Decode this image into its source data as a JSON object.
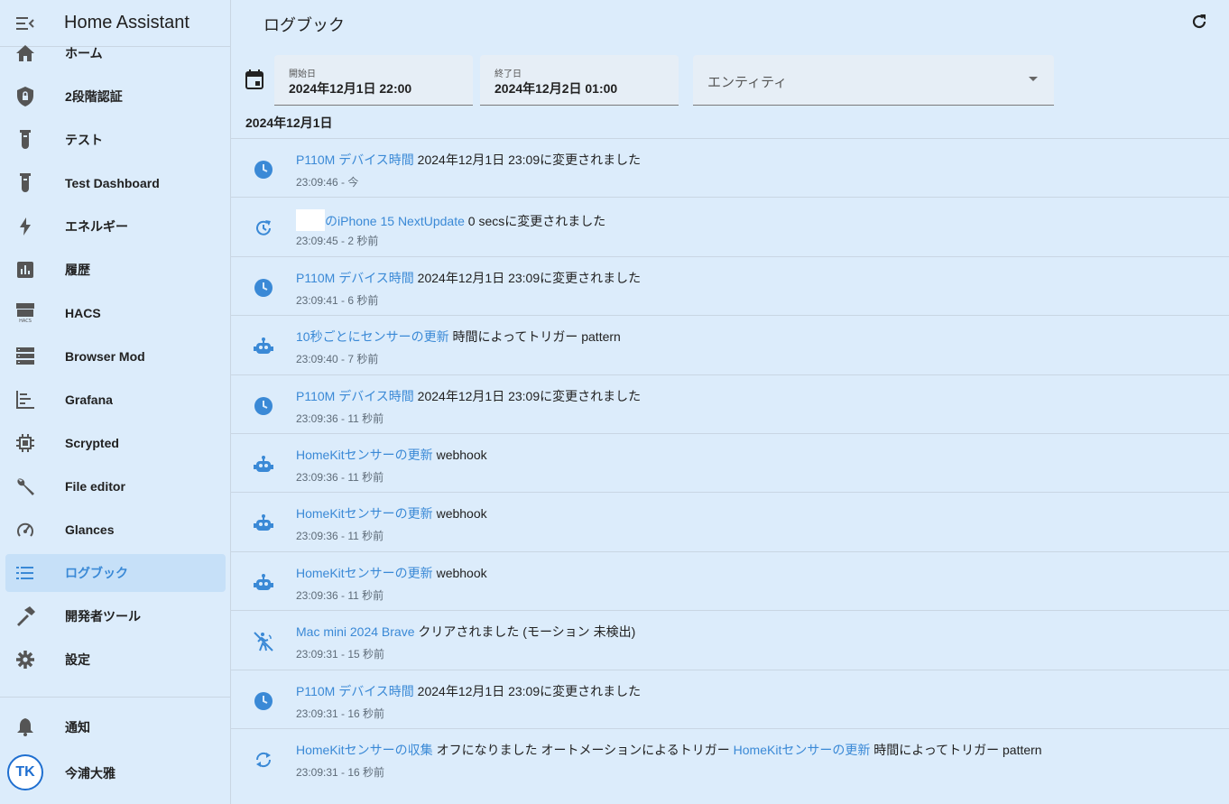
{
  "app": {
    "title": "Home Assistant"
  },
  "colors": {
    "accent": "#3a89d6",
    "background": "#dcecfb",
    "active_item_bg": "#c6e0f8"
  },
  "sidebar": {
    "items": [
      {
        "label": "ホーム",
        "icon": "home-icon"
      },
      {
        "label": "2段階認証",
        "icon": "shield-lock-icon"
      },
      {
        "label": "テスト",
        "icon": "test-tube-icon"
      },
      {
        "label": "Test Dashboard",
        "icon": "test-tube-icon"
      },
      {
        "label": "エネルギー",
        "icon": "lightning-icon"
      },
      {
        "label": "履歴",
        "icon": "chart-box-icon"
      },
      {
        "label": "HACS",
        "icon": "hacs-store-icon"
      },
      {
        "label": "Browser Mod",
        "icon": "server-icon"
      },
      {
        "label": "Grafana",
        "icon": "chart-timeline-icon"
      },
      {
        "label": "Scrypted",
        "icon": "chip-icon"
      },
      {
        "label": "File editor",
        "icon": "wrench-icon"
      },
      {
        "label": "Glances",
        "icon": "speedometer-icon"
      },
      {
        "label": "ログブック",
        "icon": "format-list-icon",
        "active": true
      },
      {
        "label": "開発者ツール",
        "icon": "hammer-icon"
      },
      {
        "label": "設定",
        "icon": "gear-icon"
      }
    ],
    "notifications_label": "通知",
    "user_name": "今浦大雅",
    "user_initials": "TK"
  },
  "main": {
    "title": "ログブック",
    "start_date_label": "開始日",
    "start_date_value": "2024年12月1日 22:00",
    "end_date_label": "終了日",
    "end_date_value": "2024年12月2日 01:00",
    "entity_placeholder": "エンティティ",
    "date_header": "2024年12月1日"
  },
  "entries": [
    {
      "icon": "clock-icon",
      "entity": "P110M デバイス時間",
      "message": " 2024年12月1日 23:09に変更されました",
      "time": "23:09:46 - 今"
    },
    {
      "icon": "update-icon",
      "entity": "のiPhone 15 NextUpdate",
      "message": " 0 secsに変更されました",
      "time": "23:09:45 - 2 秒前",
      "masked": true
    },
    {
      "icon": "clock-icon",
      "entity": "P110M デバイス時間",
      "message": " 2024年12月1日 23:09に変更されました",
      "time": "23:09:41 - 6 秒前"
    },
    {
      "icon": "robot-icon",
      "entity": "10秒ごとにセンサーの更新",
      "message": " 時間によってトリガー pattern",
      "time": "23:09:40 - 7 秒前"
    },
    {
      "icon": "clock-icon",
      "entity": "P110M デバイス時間",
      "message": " 2024年12月1日 23:09に変更されました",
      "time": "23:09:36 - 11 秒前"
    },
    {
      "icon": "robot-icon",
      "entity": "HomeKitセンサーの更新",
      "message": " webhook",
      "time": "23:09:36 - 11 秒前"
    },
    {
      "icon": "robot-icon",
      "entity": "HomeKitセンサーの更新",
      "message": " webhook",
      "time": "23:09:36 - 11 秒前"
    },
    {
      "icon": "robot-icon",
      "entity": "HomeKitセンサーの更新",
      "message": " webhook",
      "time": "23:09:36 - 11 秒前"
    },
    {
      "icon": "motion-sensor-off-icon",
      "entity": "Mac mini 2024 Brave",
      "message": " クリアされました (モーション 未検出)",
      "time": "23:09:31 - 15 秒前"
    },
    {
      "icon": "clock-icon",
      "entity": "P110M デバイス時間",
      "message": " 2024年12月1日 23:09に変更されました",
      "time": "23:09:31 - 16 秒前"
    },
    {
      "icon": "sync-icon",
      "entity": "HomeKitセンサーの収集",
      "message": " オフになりました オートメーションによるトリガー ",
      "entity2": "HomeKitセンサーの更新",
      "message2": " 時間によってトリガー pattern",
      "time": "23:09:31 - 16 秒前"
    }
  ]
}
